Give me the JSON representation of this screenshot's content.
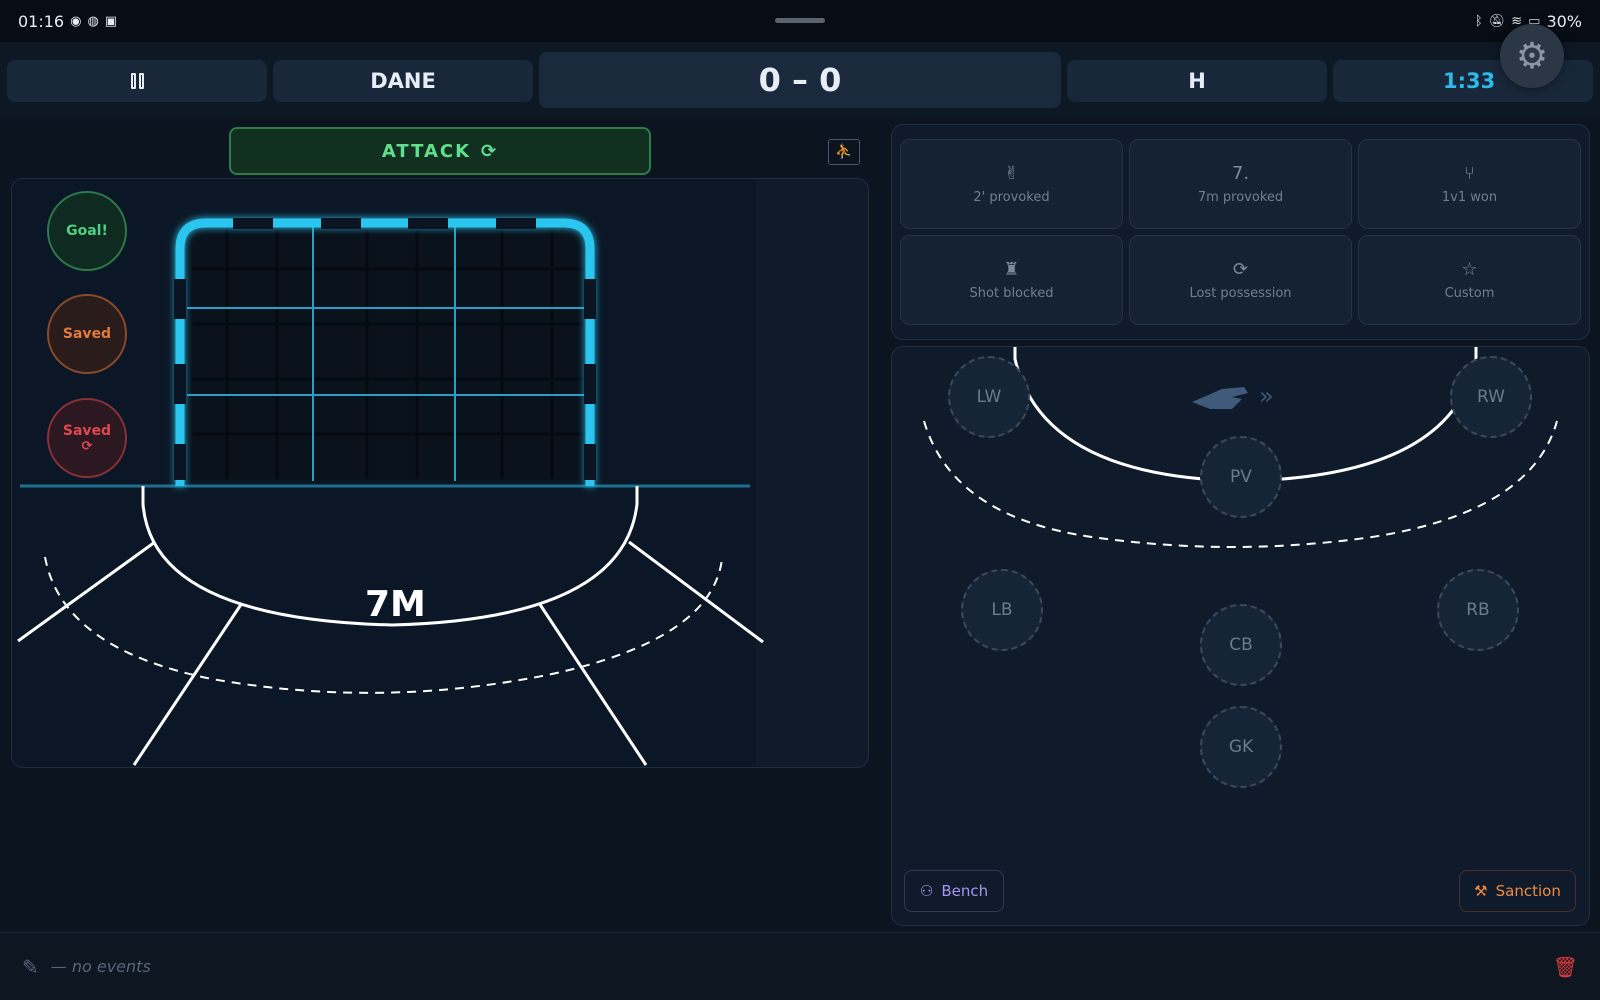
{
  "status_bar": {
    "time": "01:16",
    "battery": "30%"
  },
  "header": {
    "team": "DANE",
    "score": "0 – 0",
    "half": "H",
    "clock": "1:33"
  },
  "attack": {
    "label": "ATTACK"
  },
  "shot_buttons": {
    "goal": "Goal!",
    "saved": "Saved",
    "saved_rebound": "Saved"
  },
  "court": {
    "seven_m_label": "7M"
  },
  "actions": [
    {
      "label": "2' provoked",
      "icon": "hand-peace-icon"
    },
    {
      "label": "7m provoked",
      "icon": "seven-icon",
      "glyph": "7."
    },
    {
      "label": "1v1 won",
      "icon": "fork-arrow-icon"
    },
    {
      "label": "Shot blocked",
      "icon": "chess-rook-icon"
    },
    {
      "label": "Lost possession",
      "icon": "refresh-icon"
    },
    {
      "label": "Custom",
      "icon": "star-icon"
    }
  ],
  "positions": {
    "lw": "LW",
    "rw": "RW",
    "pv": "PV",
    "lb": "LB",
    "rb": "RB",
    "cb": "CB",
    "gk": "GK"
  },
  "field_buttons": {
    "bench": "Bench",
    "sanction": "Sanction"
  },
  "footer": {
    "events_text": "— no events"
  },
  "colors": {
    "accent_time": "#2bbbea",
    "goal_green": "#4fd183",
    "saved_orange": "#e07a3f",
    "saved_red": "#e0474f",
    "goal_frame_cyan": "#29c6f0"
  }
}
